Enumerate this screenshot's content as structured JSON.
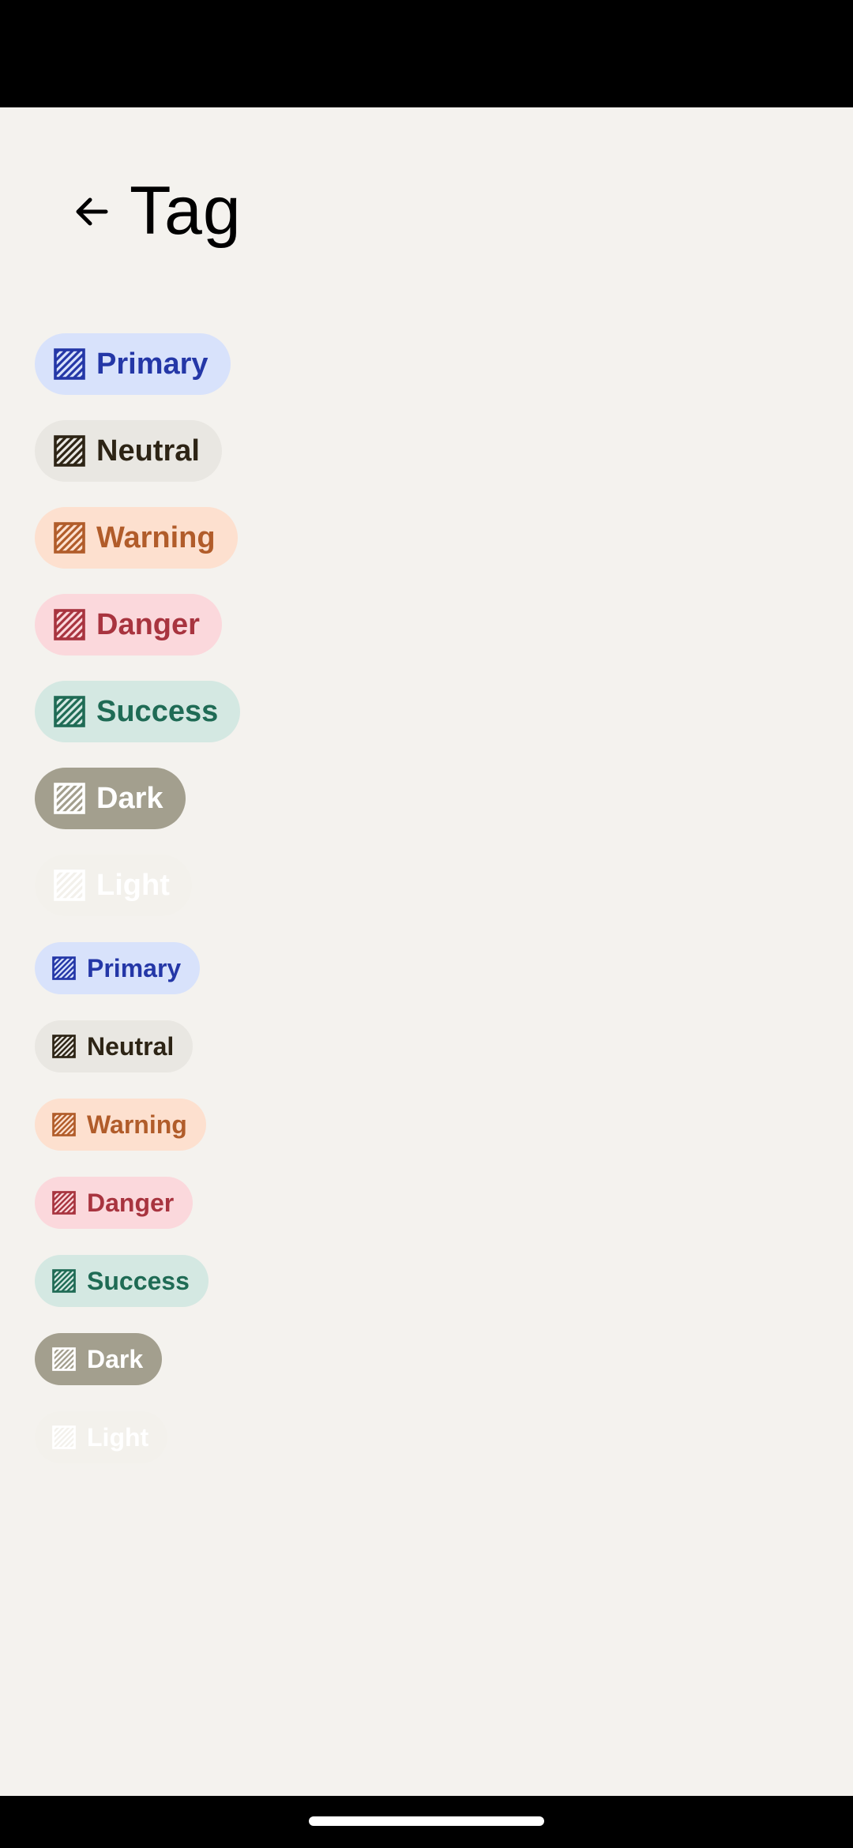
{
  "header": {
    "title": "Tag",
    "back_icon": "arrow-left-icon"
  },
  "tag_icon": "hatched-square-icon",
  "tags_large": [
    {
      "label": "Primary",
      "bg": "#d8e2fb",
      "fg": "#2437a7"
    },
    {
      "label": "Neutral",
      "bg": "#e9e7e2",
      "fg": "#2d2415"
    },
    {
      "label": "Warning",
      "bg": "#fde0cf",
      "fg": "#b15c2a"
    },
    {
      "label": "Danger",
      "bg": "#fbd8dc",
      "fg": "#a8343f"
    },
    {
      "label": "Success",
      "bg": "#d4e8e2",
      "fg": "#1f6b55"
    },
    {
      "label": "Dark",
      "bg": "#a39f8e",
      "fg": "#ffffff"
    },
    {
      "label": "Light",
      "bg": "#f3f1ec",
      "fg": "#ffffff"
    }
  ],
  "tags_small": [
    {
      "label": "Primary",
      "bg": "#d8e2fb",
      "fg": "#2437a7"
    },
    {
      "label": "Neutral",
      "bg": "#e9e7e2",
      "fg": "#2d2415"
    },
    {
      "label": "Warning",
      "bg": "#fde0cf",
      "fg": "#b15c2a"
    },
    {
      "label": "Danger",
      "bg": "#fbd8dc",
      "fg": "#a8343f"
    },
    {
      "label": "Success",
      "bg": "#d4e8e2",
      "fg": "#1f6b55"
    },
    {
      "label": "Dark",
      "bg": "#a39f8e",
      "fg": "#ffffff"
    },
    {
      "label": "Light",
      "bg": "#f3f1ec",
      "fg": "#ffffff"
    }
  ]
}
